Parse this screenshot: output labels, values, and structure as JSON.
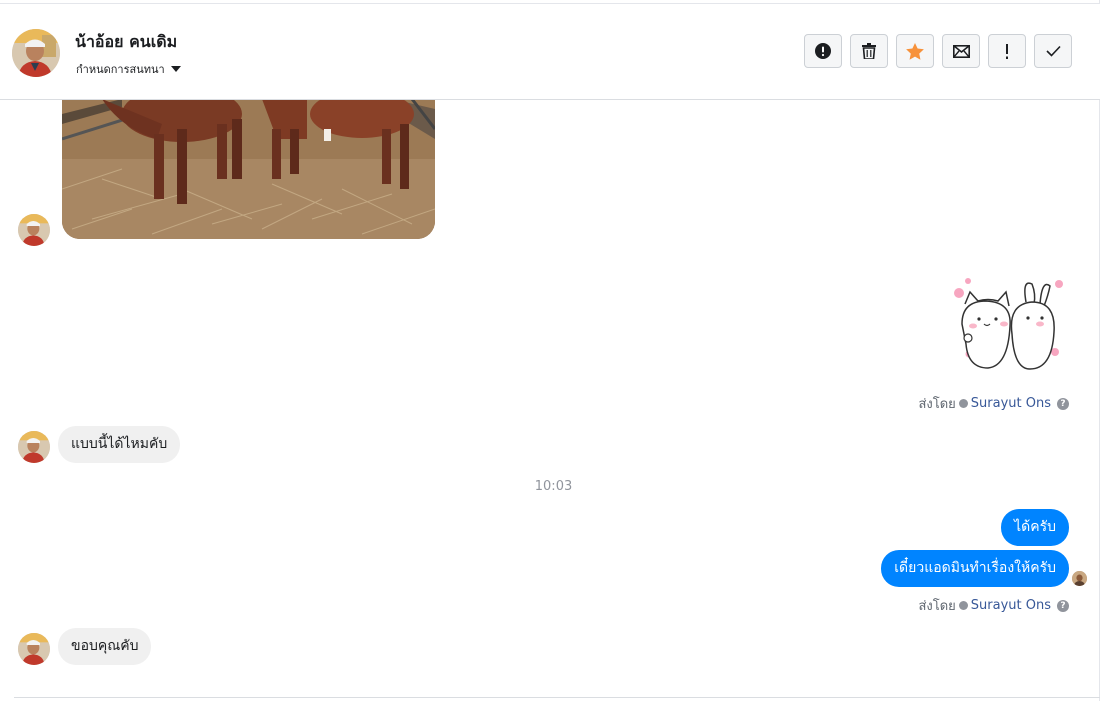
{
  "header": {
    "name": "น้าอ้อย คนเดิม",
    "assign_label": "กำหนดการสนทนา",
    "avatar_icon": "user-avatar",
    "actions": [
      {
        "name": "spam-button",
        "icon": "exclamation-circle-icon"
      },
      {
        "name": "delete-button",
        "icon": "trash-icon"
      },
      {
        "name": "star-button",
        "icon": "star-icon",
        "color": "#f7923b"
      },
      {
        "name": "mark-unread-button",
        "icon": "envelope-icon"
      },
      {
        "name": "follow-up-button",
        "icon": "exclamation-icon"
      },
      {
        "name": "mark-done-button",
        "icon": "check-icon"
      }
    ]
  },
  "messages": {
    "sticker_sent_by_prefix": "ส่งโดย",
    "sticker_sent_by_name": "Surayut Ons",
    "incoming_1": "แบบนี้ได้ไหมคับ",
    "timestamp": "10:03",
    "outgoing_1": "ได้ครับ",
    "outgoing_2": "เดี๋ยวแอดมินทำเรื่องให้ครับ",
    "sent_by_prefix": "ส่งโดย",
    "sent_by_name": "Surayut Ons",
    "incoming_2": "ขอบคุณคับ"
  },
  "colors": {
    "outgoing_bubble": "#0084ff",
    "incoming_bubble": "#f0f0f0",
    "link": "#385898",
    "star": "#f7923b"
  }
}
